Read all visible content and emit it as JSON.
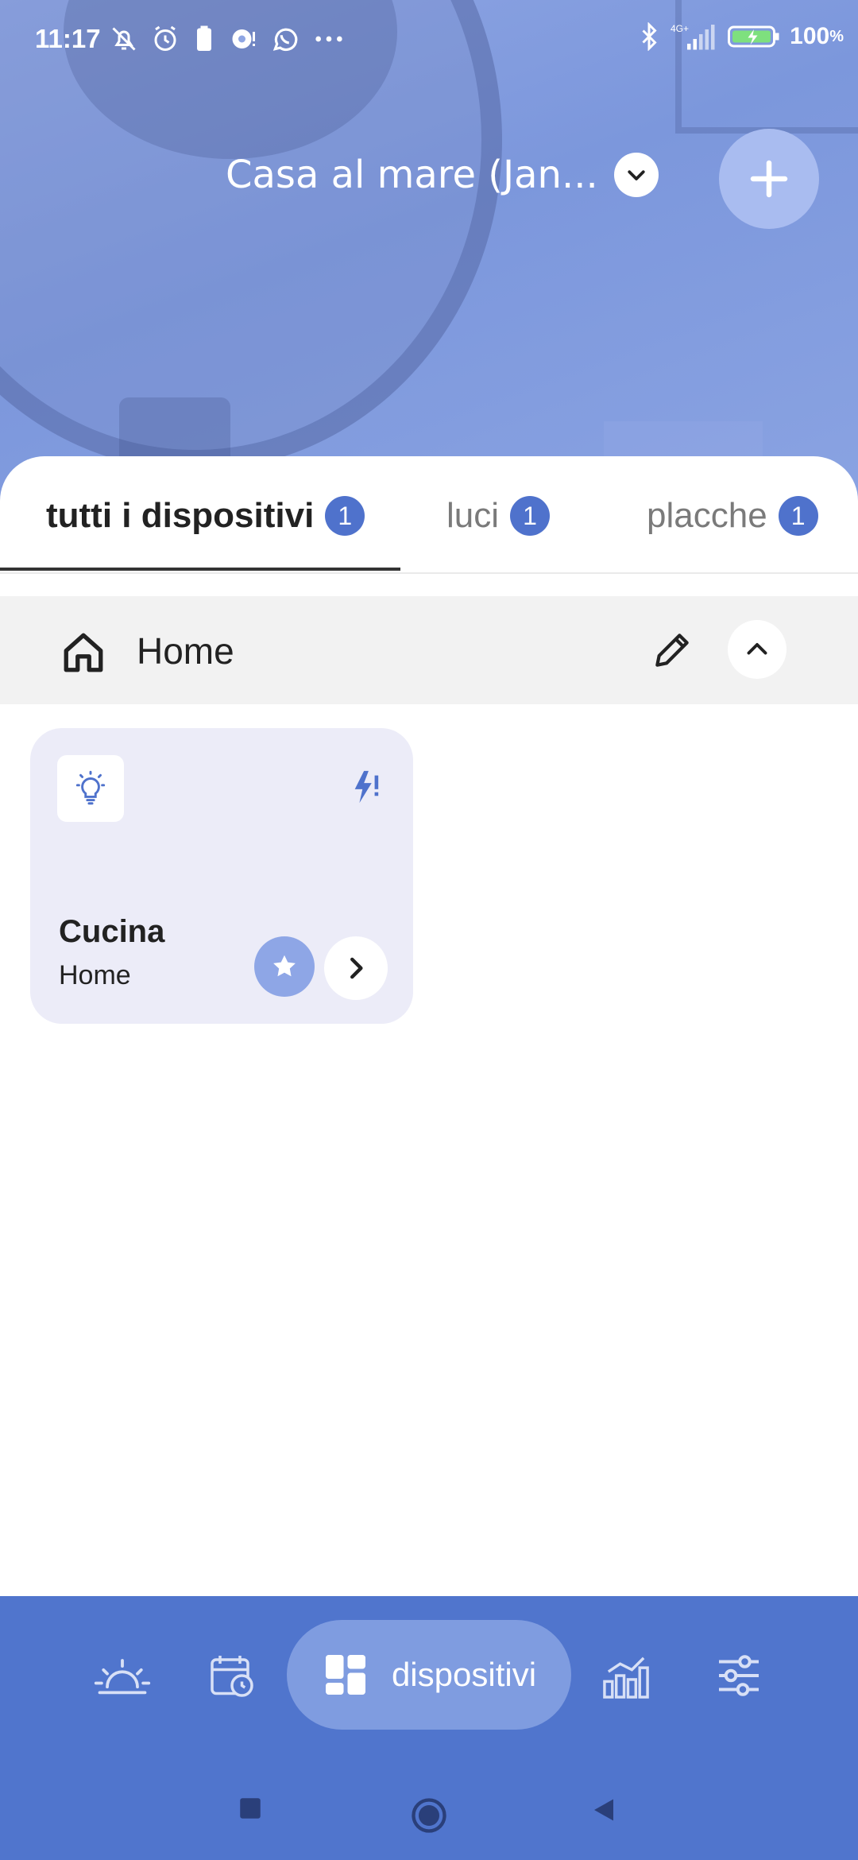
{
  "status_bar": {
    "time": "11:17",
    "network": "4G+",
    "battery": "100"
  },
  "header": {
    "home_name": "Casa al mare (Jan...",
    "dropdown_icon": "chevron-down-icon",
    "add_icon": "plus-icon"
  },
  "tabs": [
    {
      "label": "tutti i dispositivi",
      "count": "1",
      "active": true
    },
    {
      "label": "luci",
      "count": "1",
      "active": false
    },
    {
      "label": "placche",
      "count": "1",
      "active": false
    }
  ],
  "group": {
    "title": "Home",
    "icon": "house-icon"
  },
  "devices": [
    {
      "name": "Cucina",
      "room": "Home",
      "icon": "lightbulb-icon",
      "status_icon": "flash-alert-icon"
    }
  ],
  "bottom_nav": {
    "items": [
      "sunrise-icon",
      "calendar-clock-icon",
      "dashboard-icon",
      "chart-icon",
      "sliders-icon"
    ],
    "active_label": "dispositivi"
  },
  "colors": {
    "accent": "#4f72cc",
    "nav_bg": "#5075cd",
    "nav_active": "#7f9ce0",
    "card_bg": "#ececf8"
  }
}
